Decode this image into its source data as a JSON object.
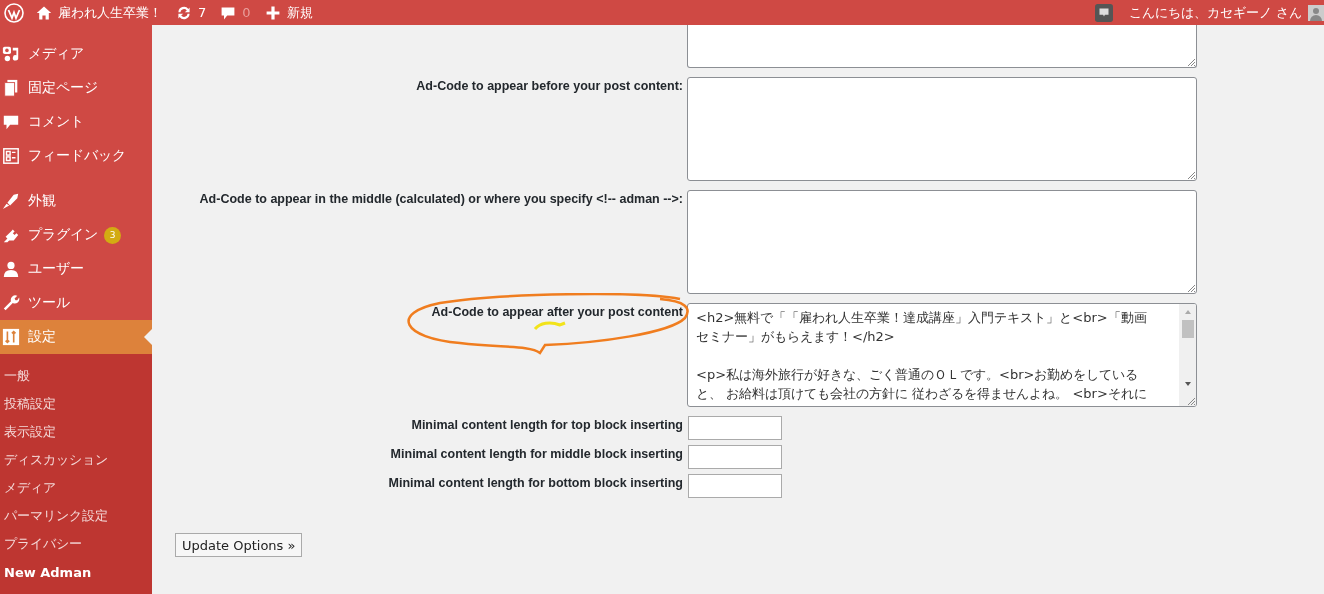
{
  "admin_bar": {
    "site_name": "雇われ人生卒業！",
    "updates": "7",
    "comments": "0",
    "new": "新規",
    "greeting": "こんにちは、カセギーノ さん"
  },
  "sidebar": {
    "groups": [
      {
        "items": [
          {
            "label": "メディア",
            "selected": false
          },
          {
            "label": "固定ページ",
            "selected": false
          },
          {
            "label": "コメント",
            "selected": false
          },
          {
            "label": "フィードバック",
            "selected": false
          }
        ]
      },
      {
        "items": [
          {
            "label": "外観",
            "selected": false
          },
          {
            "label": "プラグイン",
            "selected": false,
            "badge": "3"
          },
          {
            "label": "ユーザー",
            "selected": false
          },
          {
            "label": "ツール",
            "selected": false
          },
          {
            "label": "設定",
            "selected": true
          }
        ]
      }
    ],
    "submenu": [
      {
        "label": "一般",
        "selected": false
      },
      {
        "label": "投稿設定",
        "selected": false
      },
      {
        "label": "表示設定",
        "selected": false
      },
      {
        "label": "ディスカッション",
        "selected": false
      },
      {
        "label": "メディア",
        "selected": false
      },
      {
        "label": "パーマリンク設定",
        "selected": false
      },
      {
        "label": "プライバシー",
        "selected": false
      },
      {
        "label": "New Adman",
        "selected": true
      }
    ]
  },
  "ad_fields": [
    {
      "label": "Ad-Code to appear before your post content:"
    },
    {
      "label": "Ad-Code to appear in the middle (calculated) or where you specify <!-- adman -->:"
    },
    {
      "label": "Ad-Code to appear after your post content",
      "paragraphs": [
        [
          "<h2>無料で「「雇われ人生卒業！達成講座」入門テキスト」と<br>「動画",
          "セミナー」がもらえます！</h2>"
        ],
        [
          "<p>私は海外旅行が好きな、ごく普通のＯＬです。<br>お勤めをしている",
          "と、 お給料は頂けても会社の方針に 従わざるを得ませんよね。 <br>それに"
        ]
      ]
    }
  ],
  "length_fields": [
    {
      "label": "Minimal content length for top block inserting"
    },
    {
      "label": "Minimal content length for middle block inserting"
    },
    {
      "label": "Minimal content length for bottom block inserting"
    }
  ],
  "submit": "Update Options »"
}
